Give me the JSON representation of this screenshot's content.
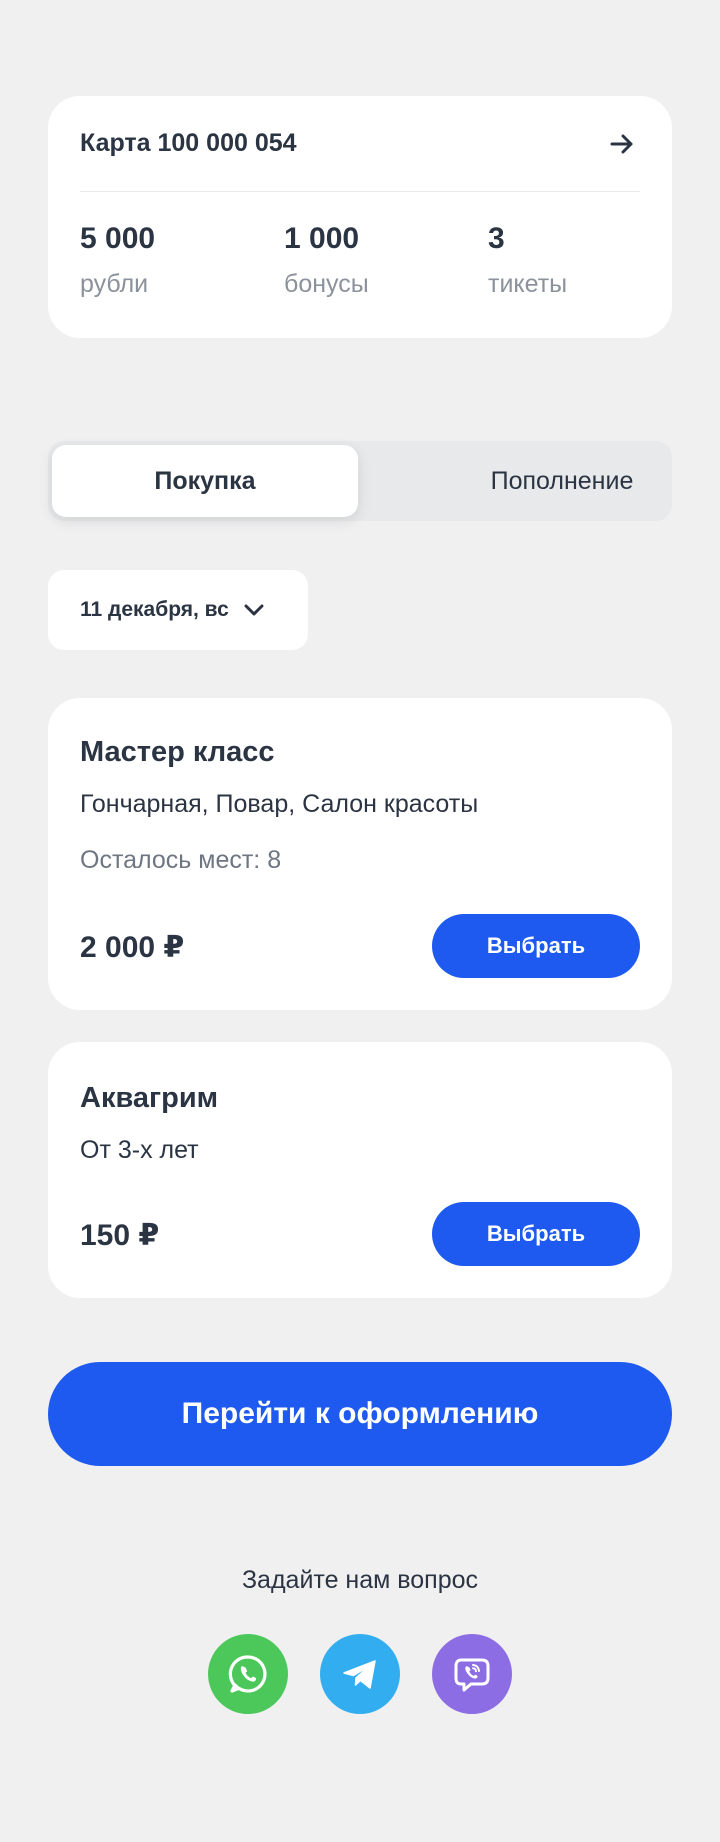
{
  "card": {
    "title": "Карта 100 000 054",
    "stats": [
      {
        "value": "5 000",
        "label": "рубли"
      },
      {
        "value": "1 000",
        "label": "бонусы"
      },
      {
        "value": "3",
        "label": "тикеты"
      }
    ]
  },
  "tabs": {
    "purchase": "Покупка",
    "topup": "Пополнение"
  },
  "date": {
    "selected": "11 декабря, вс"
  },
  "products": [
    {
      "title": "Мастер класс",
      "description": "Гончарная, Повар, Салон красоты",
      "seats": "Осталось мест: 8",
      "price": "2 000 ₽",
      "button": "Выбрать"
    },
    {
      "title": "Аквагрим",
      "description": "От 3-х лет",
      "price": "150 ₽",
      "button": "Выбрать"
    }
  ],
  "checkout": {
    "label": "Перейти к оформлению"
  },
  "contact": {
    "prompt": "Задайте нам вопрос",
    "channels": [
      "whatsapp-icon",
      "telegram-icon",
      "viber-icon"
    ]
  },
  "colors": {
    "accent": "#1f5af0",
    "background": "#f0f0f1",
    "whatsapp": "#4cc85b",
    "telegram": "#32aef0",
    "viber": "#8d6de3"
  }
}
